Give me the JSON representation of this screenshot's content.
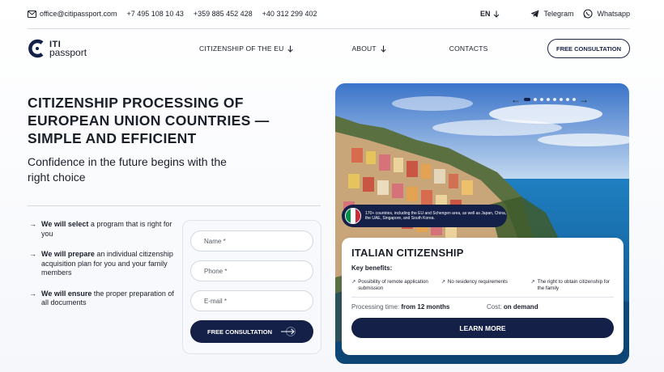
{
  "topbar": {
    "email": "office@citipassport.com",
    "phones": [
      "+7 495 108 10 43",
      "+359 885 452 428",
      "+40 312 299 402"
    ],
    "language": "EN",
    "telegram": "Telegram",
    "whatsapp": "Whatsapp"
  },
  "logo": {
    "line1": "ITI",
    "line2": "passport"
  },
  "nav": {
    "items": [
      {
        "label": "CITIZENSHIP OF THE EU"
      },
      {
        "label": "ABOUT"
      },
      {
        "label": "CONTACTS"
      }
    ],
    "cta": "FREE CONSULTATION"
  },
  "hero": {
    "title": "CITIZENSHIP PROCESSING OF EUROPEAN UNION COUNTRIES — SIMPLE AND EFFICIENT",
    "subtitle": "Confidence in the future begins with the right choice"
  },
  "benefits": [
    {
      "bold": "We will select",
      "rest": " a program that is right for you"
    },
    {
      "bold": "We will prepare",
      "rest": " an individual citizenship acquisition plan for you and your family members"
    },
    {
      "bold": "We will ensure",
      "rest": " the proper preparation of all documents"
    }
  ],
  "form": {
    "name_placeholder": "Name *",
    "phone_placeholder": "Phone *",
    "email_placeholder": "E-mail *",
    "submit": "FREE CONSULTATION"
  },
  "badge": {
    "text": "170+ countries, including the EU and Schengen area, as well as Japan, China, the UAE, Singapore, and South Korea.",
    "flag_colors": [
      "#009246",
      "#ffffff",
      "#ce2b37"
    ]
  },
  "card": {
    "title": "ITALIAN CITIZENSHIP",
    "key_benefits_label": "Key benefits:",
    "key_benefits": [
      "Possibility of remote application submission",
      "No residency requirements",
      "The right to obtain citizenship for the family"
    ],
    "processing_label": "Processing time:",
    "processing_value": "from 12 months",
    "cost_label": "Cost:",
    "cost_value": "on demand",
    "button": "LEARN MORE"
  },
  "slider": {
    "dots": 8,
    "active": 1
  },
  "colors": {
    "primary": "#142048",
    "accent_text": "#1b1f2a"
  }
}
